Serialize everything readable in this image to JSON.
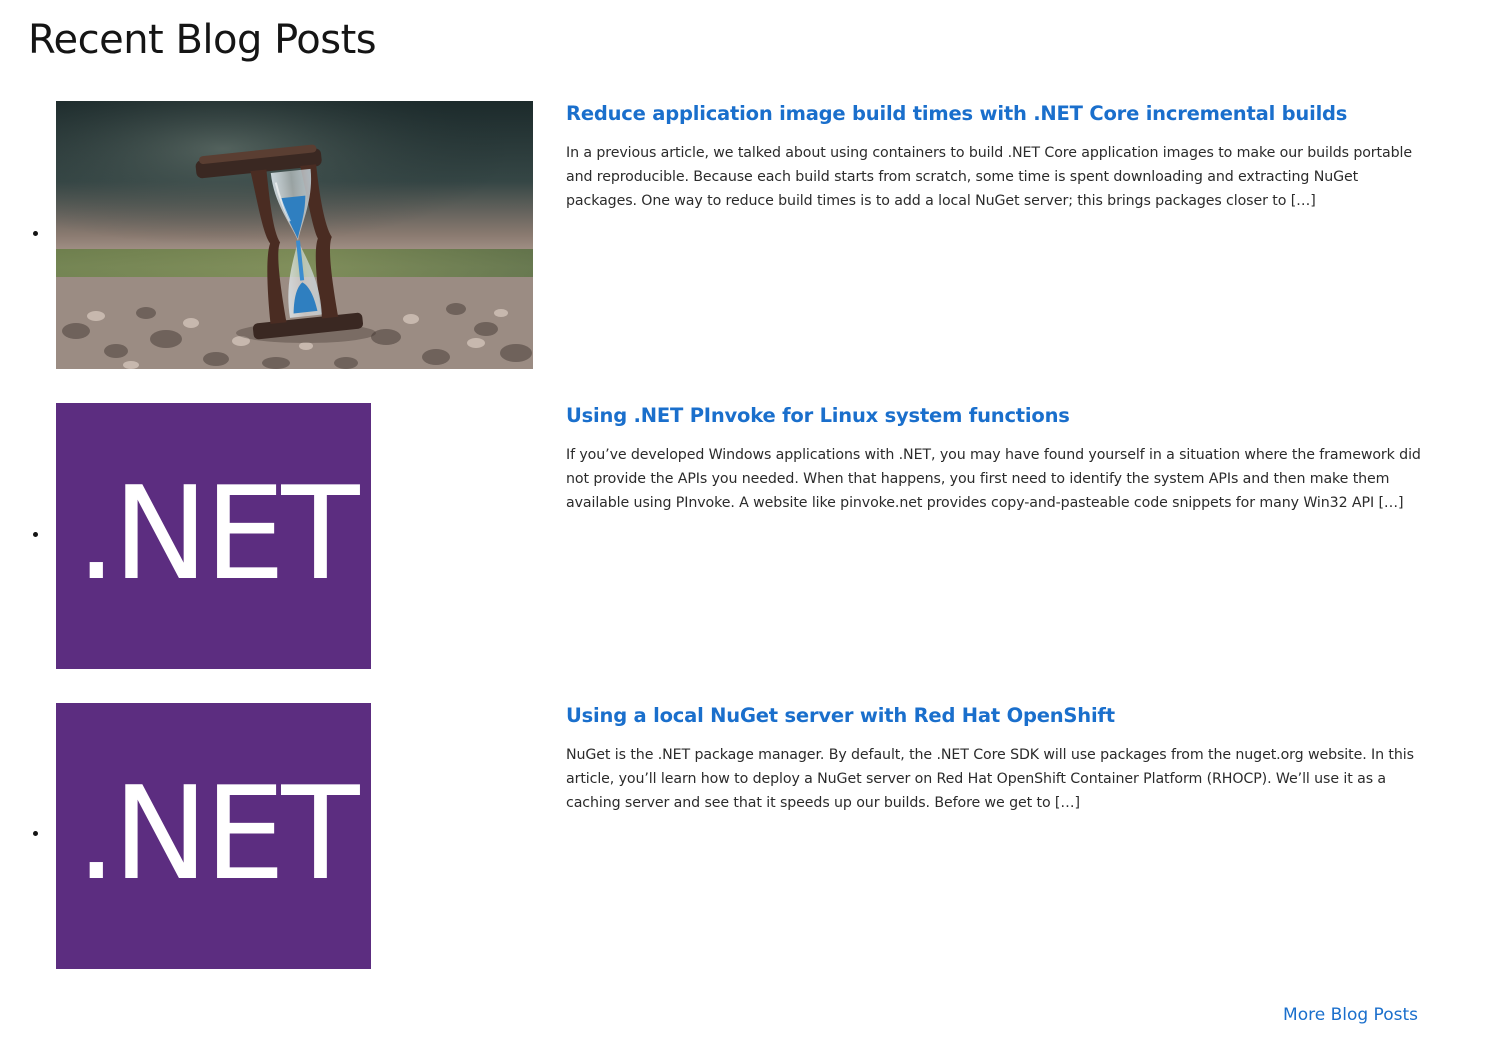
{
  "page": {
    "title": "Recent Blog Posts"
  },
  "posts": [
    {
      "title": "Reduce application image build times with .NET Core incremental builds",
      "excerpt": "In a previous article, we talked about using containers to build .NET Core application images to make our builds portable and reproducible. Because each build starts from scratch, some time is spent downloading and extracting NuGet packages. One way to reduce build times is to add a local NuGet server; this brings packages closer to […]",
      "thumbnail": "hourglass-photo"
    },
    {
      "title": "Using .NET PInvoke for Linux system functions",
      "excerpt": "If you’ve developed Windows applications with .NET, you may have found yourself in a situation where the framework did not provide the APIs you needed. When that happens, you first need to identify the system APIs and then make them available using PInvoke. A website like pinvoke.net provides copy-and-pasteable code snippets for many Win32 API […]",
      "thumbnail": ".NET"
    },
    {
      "title": "Using a local NuGet server with Red Hat OpenShift",
      "excerpt": "NuGet is the .NET package manager. By default, the .NET Core SDK will use packages from the nuget.org website. In this article, you’ll learn how to deploy a NuGet server on Red Hat OpenShift Container Platform (RHOCP). We’ll use it as a caching server and see that it speeds up our builds. Before we get to […]",
      "thumbnail": ".NET"
    }
  ],
  "more_link": "More Blog Posts",
  "colors": {
    "link": "#1a6fcc",
    "dotnet_purple": "#5c2d80",
    "text": "#151515"
  }
}
